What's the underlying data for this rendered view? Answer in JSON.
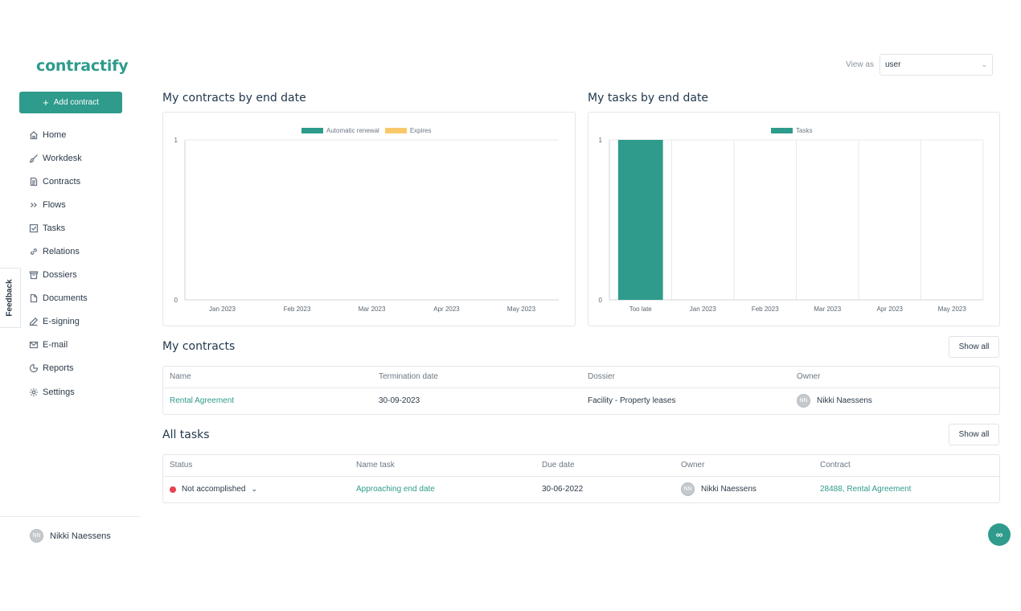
{
  "brand": {
    "logo_text": "contractify",
    "accent": "#2e9b8c"
  },
  "sidebar": {
    "add_button_label": "Add contract",
    "items": [
      {
        "label": "Home",
        "icon": "home-icon"
      },
      {
        "label": "Workdesk",
        "icon": "brush-icon"
      },
      {
        "label": "Contracts",
        "icon": "document-icon"
      },
      {
        "label": "Flows",
        "icon": "double-chevron-icon"
      },
      {
        "label": "Tasks",
        "icon": "checkbox-icon"
      },
      {
        "label": "Relations",
        "icon": "link-icon"
      },
      {
        "label": "Dossiers",
        "icon": "archive-icon"
      },
      {
        "label": "Documents",
        "icon": "file-icon"
      },
      {
        "label": "E-signing",
        "icon": "pen-icon"
      },
      {
        "label": "E-mail",
        "icon": "mail-icon"
      },
      {
        "label": "Reports",
        "icon": "pie-icon"
      },
      {
        "label": "Settings",
        "icon": "gear-icon"
      }
    ],
    "user": {
      "initials": "NN",
      "name": "Nikki Naessens"
    }
  },
  "feedback_label": "Feedback",
  "header": {
    "view_as_label": "View as",
    "view_as_value": "user"
  },
  "contracts_chart": {
    "title": "My contracts by end date",
    "legend": [
      {
        "label": "Automatic renewal",
        "color": "#2e9b8c"
      },
      {
        "label": "Expires",
        "color": "#f8c96b"
      }
    ]
  },
  "tasks_chart": {
    "title": "My tasks by end date",
    "legend": [
      {
        "label": "Tasks",
        "color": "#2e9b8c"
      }
    ]
  },
  "chart_data": [
    {
      "type": "bar",
      "title": "My contracts by end date",
      "categories": [
        "Jan 2023",
        "Feb 2023",
        "Mar 2023",
        "Apr 2023",
        "May 2023"
      ],
      "series": [
        {
          "name": "Automatic renewal",
          "values": [
            0,
            0,
            0,
            0,
            0
          ]
        },
        {
          "name": "Expires",
          "values": [
            0,
            0,
            0,
            0,
            0
          ]
        }
      ],
      "ylim": [
        0,
        1
      ],
      "yticks": [
        "0",
        "1"
      ],
      "grid": false,
      "legend": "top"
    },
    {
      "type": "bar",
      "title": "My tasks by end date",
      "categories": [
        "Too late",
        "Jan 2023",
        "Feb 2023",
        "Mar 2023",
        "Apr 2023",
        "May 2023"
      ],
      "series": [
        {
          "name": "Tasks",
          "values": [
            1,
            0,
            0,
            0,
            0,
            0
          ]
        }
      ],
      "ylim": [
        0,
        1
      ],
      "yticks": [
        "0",
        "1"
      ],
      "grid": true,
      "legend": "top"
    }
  ],
  "my_contracts": {
    "title": "My contracts",
    "show_all": "Show all",
    "columns": [
      "Name",
      "Termination date",
      "Dossier",
      "Owner"
    ],
    "rows": [
      {
        "name": "Rental Agreement",
        "termination_date": "30-09-2023",
        "dossier": "Facility - Property leases",
        "owner_initials": "NN",
        "owner": "Nikki Naessens"
      }
    ]
  },
  "all_tasks": {
    "title": "All tasks",
    "show_all": "Show all",
    "columns": [
      "Status",
      "Name task",
      "Due date",
      "Owner",
      "Contract"
    ],
    "rows": [
      {
        "status": "Not accomplished",
        "name_task": "Approaching end date",
        "due_date": "30-06-2022",
        "owner_initials": "NN",
        "owner": "Nikki Naessens",
        "contract": "28488, Rental Agreement"
      }
    ]
  },
  "chat_button_icon": "chat-icon"
}
